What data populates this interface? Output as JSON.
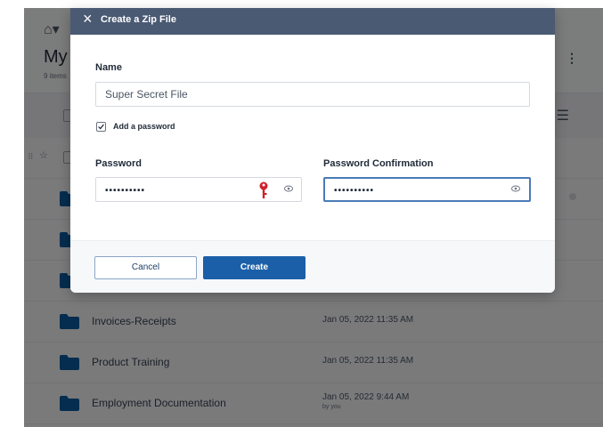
{
  "app": {
    "title": "My",
    "item_count": "9 items",
    "colors": {
      "brand_blue": "#1b5fa8",
      "header_slate": "#4a5a73",
      "folder_blue": "#0b5a9e"
    }
  },
  "files": [
    {
      "name": "",
      "date": "",
      "by": ""
    },
    {
      "name": "",
      "date": "",
      "by": ""
    },
    {
      "name": "",
      "date": "",
      "by": ""
    },
    {
      "name": "",
      "date": "",
      "by": ""
    },
    {
      "name": "Invoices-Receipts",
      "date": "Jan 05, 2022 11:35 AM",
      "by": ""
    },
    {
      "name": "Product Training",
      "date": "Jan 05, 2022 11:35 AM",
      "by": ""
    },
    {
      "name": "Employment Documentation",
      "date": "Jan 05, 2022 9:44 AM",
      "by": "by you"
    }
  ],
  "modal": {
    "title": "Create a Zip File",
    "close_icon": "×",
    "name_label": "Name",
    "name_value": "Super Secret File",
    "add_password_label": "Add a password",
    "add_password_checked": true,
    "password_label": "Password",
    "password_value": "••••••••••",
    "confirm_label": "Password Confirmation",
    "confirm_value": "••••••••••",
    "cancel_label": "Cancel",
    "create_label": "Create"
  }
}
